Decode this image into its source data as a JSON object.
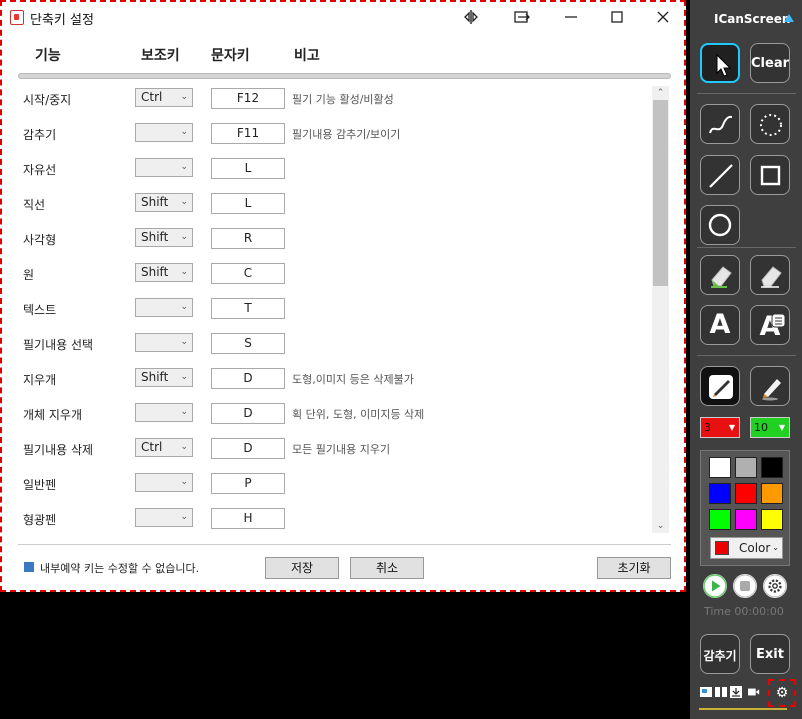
{
  "dialog": {
    "title": "단축키 설정",
    "columns": [
      "기능",
      "보조키",
      "문자키",
      "비고"
    ],
    "rows": [
      {
        "label": "시작/중지",
        "modifier": "Ctrl",
        "key": "F12",
        "note": "필기 기능 활성/비활성"
      },
      {
        "label": "감추기",
        "modifier": "",
        "key": "F11",
        "note": "필기내용 감추기/보이기"
      },
      {
        "label": "자유선",
        "modifier": "",
        "key": "L",
        "note": ""
      },
      {
        "label": "직선",
        "modifier": "Shift",
        "key": "L",
        "note": ""
      },
      {
        "label": "사각형",
        "modifier": "Shift",
        "key": "R",
        "note": ""
      },
      {
        "label": "원",
        "modifier": "Shift",
        "key": "C",
        "note": ""
      },
      {
        "label": "텍스트",
        "modifier": "",
        "key": "T",
        "note": ""
      },
      {
        "label": "필기내용 선택",
        "modifier": "",
        "key": "S",
        "note": ""
      },
      {
        "label": "지우개",
        "modifier": "Shift",
        "key": "D",
        "note": "도형,이미지 등은 삭제불가"
      },
      {
        "label": "개체 지우개",
        "modifier": "",
        "key": "D",
        "note": "획 단위, 도형, 이미지등 삭제"
      },
      {
        "label": "필기내용 삭제",
        "modifier": "Ctrl",
        "key": "D",
        "note": "모든 필기내용 지우기"
      },
      {
        "label": "일반펜",
        "modifier": "",
        "key": "P",
        "note": ""
      },
      {
        "label": "형광펜",
        "modifier": "",
        "key": "H",
        "note": ""
      }
    ],
    "footer_note": "내부예약 키는 수정할 수 없습니다.",
    "save_label": "저장",
    "cancel_label": "취소",
    "reset_label": "초기화"
  },
  "panel": {
    "title": "ICanScreen",
    "clear_label": "Clear",
    "text_tool_label": "A",
    "thickness": "3",
    "size": "10",
    "thickness_color": "#e81010",
    "size_color": "#22d022",
    "palette": [
      "#ffffff",
      "#b0b0b0",
      "#000000",
      "#0000ff",
      "#ff0000",
      "#ff9900",
      "#00ff00",
      "#ff00ff",
      "#ffff00"
    ],
    "color_label": "Color",
    "time": "Time 00:00:00",
    "hide_label": "감추기",
    "exit_label": "Exit",
    "accent_color": "#1fc9ff"
  }
}
